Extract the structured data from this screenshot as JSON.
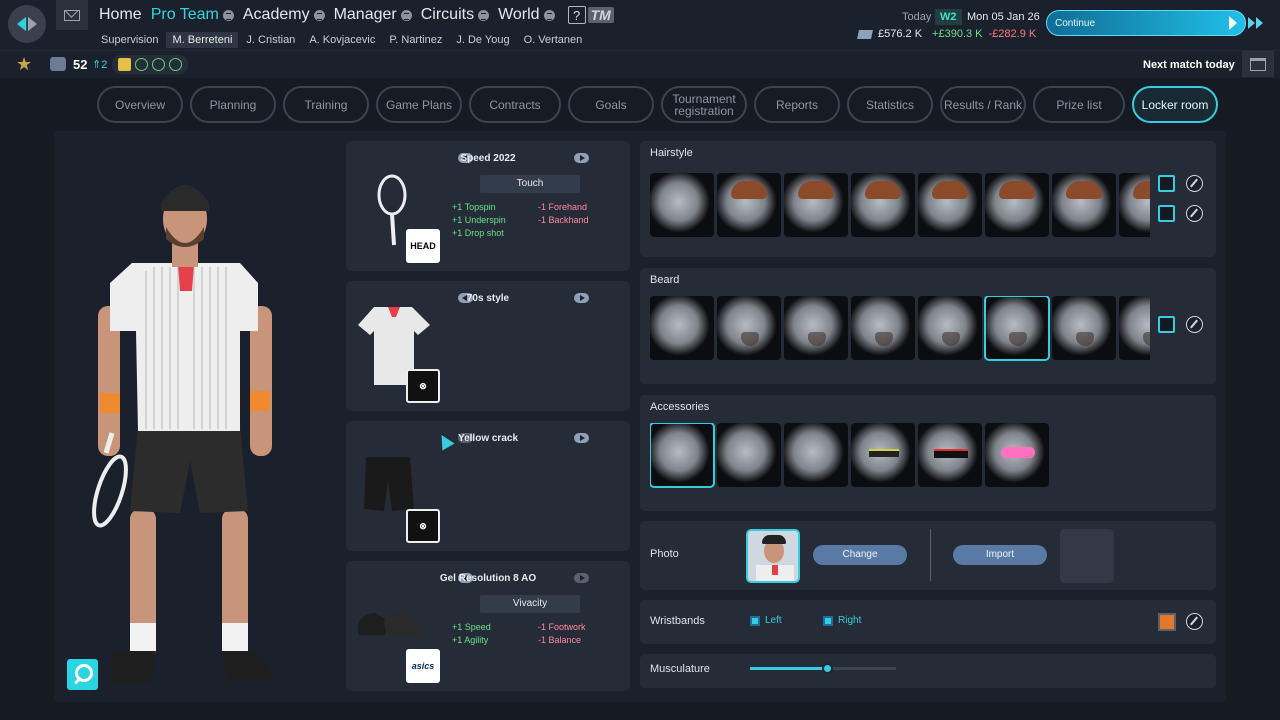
{
  "nav": {
    "main": [
      {
        "label": "Home",
        "icon": ""
      },
      {
        "label": "Pro Team",
        "icon": "menu-dot-icon",
        "active": true
      },
      {
        "label": "Academy",
        "icon": "menu-dot-icon"
      },
      {
        "label": "Manager",
        "icon": "menu-dot-icon"
      },
      {
        "label": "Circuits",
        "icon": "menu-dot-icon"
      },
      {
        "label": "World",
        "icon": "menu-dot-icon"
      }
    ],
    "help": "?",
    "tm": "TM",
    "sub": [
      "Supervision",
      "M. Berreteni",
      "J. Cristian",
      "A. Kovjacevic",
      "P. Nartinez",
      "J. De Youg",
      "O. Vertanen"
    ],
    "sub_active": 1
  },
  "header": {
    "today_label": "Today",
    "week": "W2",
    "date": "Mon 05 Jan 26",
    "cash": "£576.2 K",
    "income": "+£390.3 K",
    "expense": "-£282.9 K",
    "continue_label": "Continue",
    "next_match": "Next match today"
  },
  "player_status": {
    "level": "52",
    "rank_change": "2"
  },
  "tabs": [
    "Overview",
    "Planning",
    "Training",
    "Game Plans",
    "Contracts",
    "Goals",
    "Tournament registration",
    "Reports",
    "Statistics",
    "Results / Rank",
    "Prize list",
    "Locker room"
  ],
  "active_tab": "Locker room",
  "equipment": [
    {
      "name": "Speed 2022",
      "style": "Touch",
      "plus": [
        "+1 Topspin",
        "+1 Underspin",
        "+1 Drop shot"
      ],
      "minus": [
        "-1 Forehand",
        "-1 Backhand"
      ],
      "brand": "HEAD"
    },
    {
      "name": "70s style",
      "style": "",
      "plus": [],
      "minus": [],
      "brand": "⊗"
    },
    {
      "name": "Yellow crack",
      "style": "",
      "plus": [],
      "minus": [],
      "brand": "⊗"
    },
    {
      "name": "Gel Resolution 8 AO",
      "style": "Vivacity",
      "plus": [
        "+1 Speed",
        "+1 Agility"
      ],
      "minus": [
        "-1 Footwork",
        "-1 Balance"
      ],
      "brand": "asics"
    }
  ],
  "customize": {
    "hairstyle": "Hairstyle",
    "beard": "Beard",
    "accessories": "Accessories",
    "photo": "Photo",
    "change": "Change",
    "import": "Import",
    "wristbands": "Wristbands",
    "left": "Left",
    "right": "Right",
    "musculature": "Musculature",
    "musculature_level": 0.53,
    "wristband_color": "#e07a2a",
    "accent": "#36cde0"
  }
}
